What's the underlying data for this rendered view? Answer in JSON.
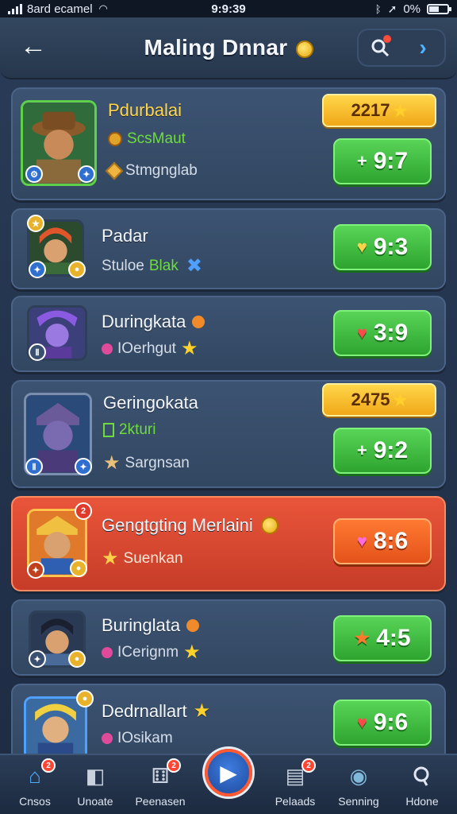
{
  "status_bar": {
    "carrier": "8ard ecamel",
    "time": "9:9:39",
    "battery": "0%"
  },
  "header": {
    "title": "Maling Dnnar",
    "back_icon": "back-arrow-icon",
    "search_icon": "search-icon",
    "next_icon": "chevron-right-icon"
  },
  "rows": [
    {
      "name": "Pdurbalai",
      "sub1": "ScsMaut",
      "sub2": "Stmgnglab",
      "score": "9:7",
      "score_icon": "plus",
      "points": "2217",
      "highlight": false
    },
    {
      "name": "Padar",
      "sub1": "Stuloe",
      "sub1_accent": "Blak",
      "score": "9:3",
      "score_icon": "heart",
      "highlight": false
    },
    {
      "name": "Duringkata",
      "sub1": "IOerhgut",
      "score": "3:9",
      "score_icon": "heart",
      "highlight": false
    },
    {
      "name": "Geringokata",
      "sub1": "2kturi",
      "sub2": "Sargnsan",
      "score": "9:2",
      "score_icon": "plus",
      "points": "2475",
      "highlight": false
    },
    {
      "name": "Gengtgting Merlaini",
      "sub1": "Suenkan",
      "score": "8:6",
      "score_icon": "heart",
      "highlight": true
    },
    {
      "name": "Buringlata",
      "sub1": "ICerignm",
      "score": "4:5",
      "score_icon": "star",
      "highlight": false
    },
    {
      "name": "Dedrnallart",
      "sub1": "IOsikam",
      "score": "9:6",
      "score_icon": "heart",
      "highlight": false
    }
  ],
  "bottom_nav": [
    {
      "label": "Cnsos",
      "icon": "home-icon",
      "badge": "2"
    },
    {
      "label": "Unoate",
      "icon": "cube-icon",
      "badge": ""
    },
    {
      "label": "Peenasen",
      "icon": "dice-icon",
      "badge": "2"
    },
    {
      "label": "",
      "icon": "play-icon",
      "badge": ""
    },
    {
      "label": "Pelaads",
      "icon": "chest-icon",
      "badge": "2"
    },
    {
      "label": "Senning",
      "icon": "target-icon",
      "badge": ""
    },
    {
      "label": "Hdone",
      "icon": "search-icon",
      "badge": ""
    }
  ]
}
